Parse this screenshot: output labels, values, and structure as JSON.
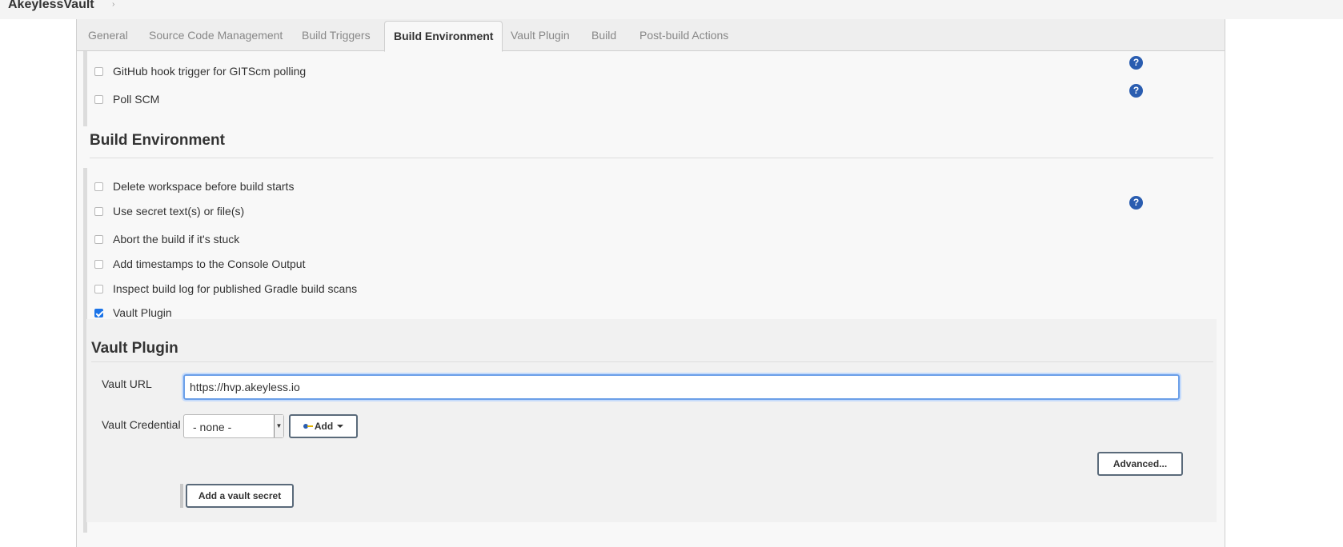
{
  "header": {
    "breadcrumb": "AkeylessVault",
    "crumb_arrow": "›"
  },
  "tabs": [
    {
      "label": "General"
    },
    {
      "label": "Source Code Management"
    },
    {
      "label": "Build Triggers"
    },
    {
      "label": "Build Environment",
      "active": true
    },
    {
      "label": "Vault Plugin"
    },
    {
      "label": "Build"
    },
    {
      "label": "Post-build Actions"
    }
  ],
  "triggers": {
    "items": [
      {
        "label": "GitHub hook trigger for GITScm polling",
        "checked": false
      },
      {
        "label": "Poll SCM",
        "checked": false
      }
    ]
  },
  "build_env": {
    "title": "Build Environment",
    "items": [
      {
        "label": "Delete workspace before build starts",
        "checked": false
      },
      {
        "label": "Use secret text(s) or file(s)",
        "checked": false
      },
      {
        "label": "Abort the build if it's stuck",
        "checked": false
      },
      {
        "label": "Add timestamps to the Console Output",
        "checked": false
      },
      {
        "label": "Inspect build log for published Gradle build scans",
        "checked": false
      },
      {
        "label": "Vault Plugin",
        "checked": true
      }
    ]
  },
  "vault": {
    "title": "Vault Plugin",
    "url_label": "Vault URL",
    "url_value": "https://hvp.akeyless.io",
    "credential_label": "Vault Credential",
    "credential_selected": "- none -",
    "add_label": "Add",
    "advanced_label": "Advanced...",
    "add_secret_label": "Add a vault secret"
  },
  "help_glyph": "?",
  "colors": {
    "accent": "#2a5db0",
    "focus": "#6b9fe8",
    "checked": "#1a73e8"
  }
}
